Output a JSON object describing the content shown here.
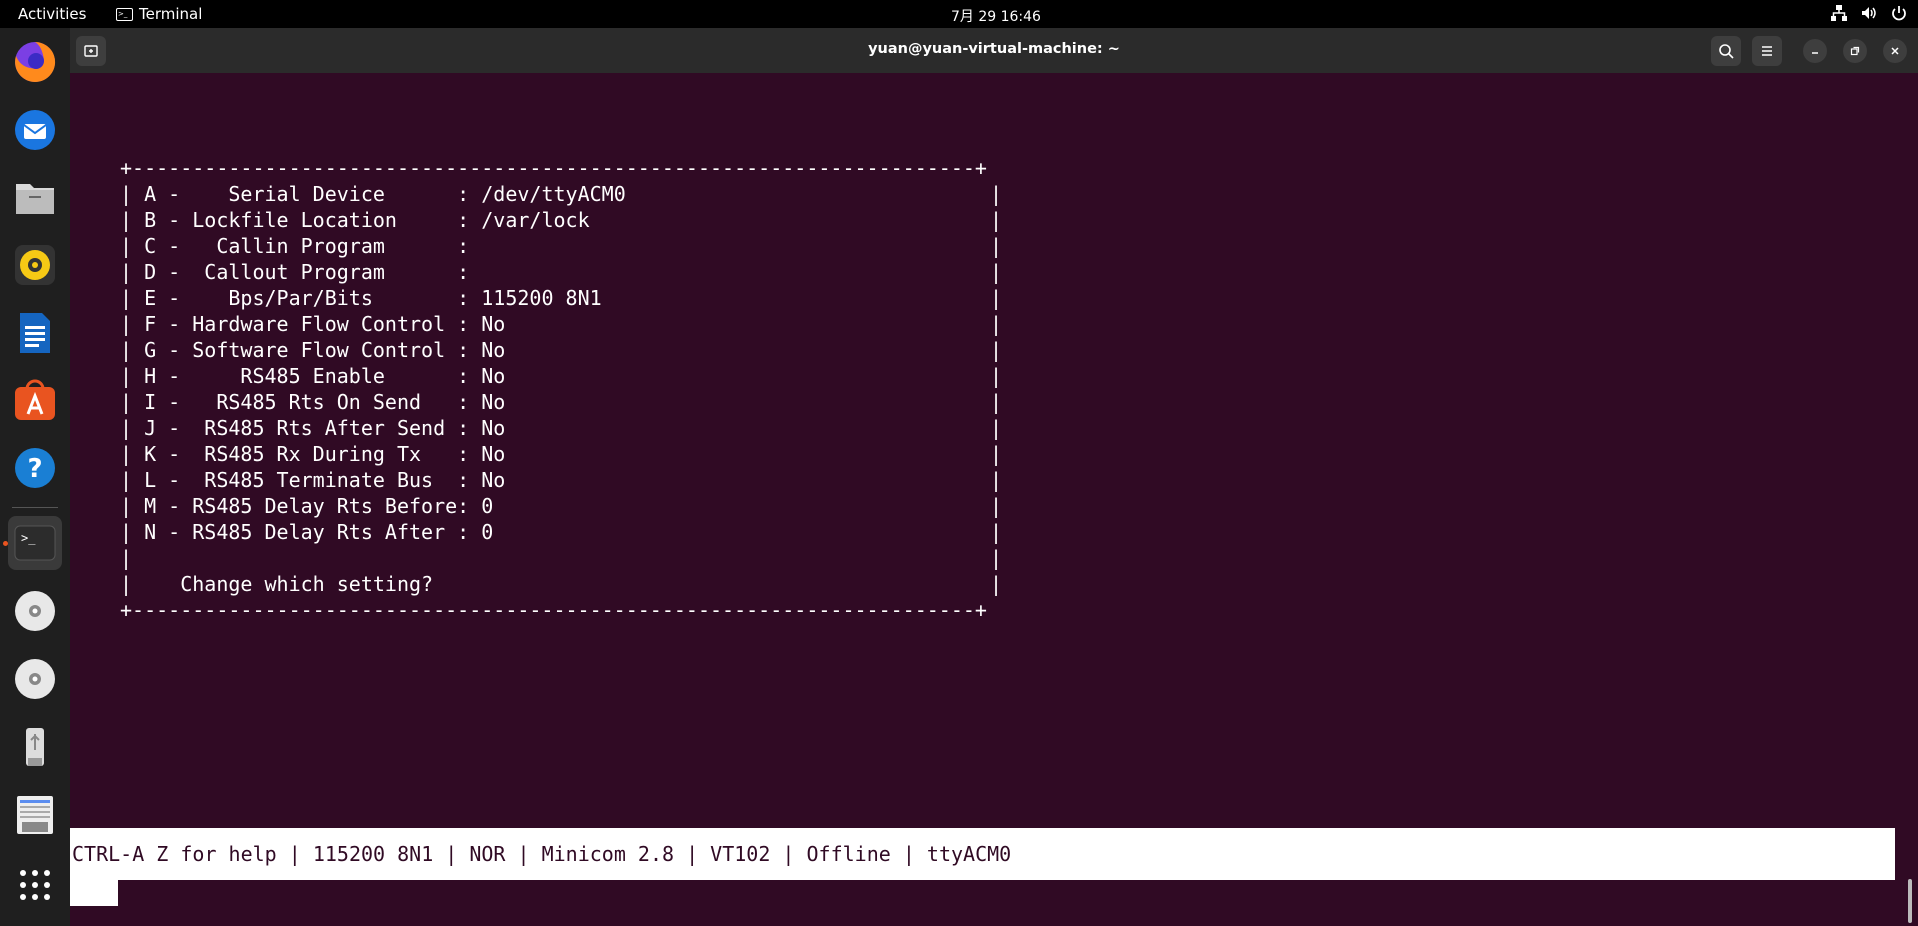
{
  "topbar": {
    "activities": "Activities",
    "app_name": "Terminal",
    "clock": "7月 29  16:46",
    "tray_icons": [
      "network-icon",
      "volume-icon",
      "power-icon"
    ]
  },
  "dock": {
    "items": [
      "firefox-icon",
      "thunderbird-icon",
      "files-icon",
      "rhythmbox-icon",
      "writer-icon",
      "app-center-icon",
      "help-icon",
      "terminal-icon",
      "dvd-icon",
      "dvd-icon",
      "usb-drive-icon",
      "trash-icon",
      "show-apps-icon"
    ],
    "accent": "#e95420"
  },
  "window": {
    "title": "yuan@yuan-virtual-machine: ~",
    "colors": {
      "background": "#300a24",
      "titlebar": "#2b2b2b"
    }
  },
  "minicom": {
    "border_top": "+----------------------------------------------------------------------+",
    "settings": [
      {
        "key": "A",
        "label": "   Serial Device      ",
        "value": "/dev/ttyACM0"
      },
      {
        "key": "B",
        "label": "Lockfile Location     ",
        "value": "/var/lock"
      },
      {
        "key": "C",
        "label": "  Callin Program      ",
        "value": ""
      },
      {
        "key": "D",
        "label": " Callout Program      ",
        "value": ""
      },
      {
        "key": "E",
        "label": "   Bps/Par/Bits       ",
        "value": "115200 8N1"
      },
      {
        "key": "F",
        "label": "Hardware Flow Control ",
        "value": "No"
      },
      {
        "key": "G",
        "label": "Software Flow Control ",
        "value": "No"
      },
      {
        "key": "H",
        "label": "    RS485 Enable      ",
        "value": "No"
      },
      {
        "key": "I",
        "label": "  RS485 Rts On Send   ",
        "value": "No"
      },
      {
        "key": "J",
        "label": " RS485 Rts After Send ",
        "value": "No"
      },
      {
        "key": "K",
        "label": " RS485 Rx During Tx   ",
        "value": "No"
      },
      {
        "key": "L",
        "label": " RS485 Terminate Bus  ",
        "value": "No"
      },
      {
        "key": "M",
        "label": "RS485 Delay Rts Before",
        "value": "0"
      },
      {
        "key": "N",
        "label": "RS485 Delay Rts After ",
        "value": "0"
      }
    ],
    "prompt": "Change which setting?",
    "status_line": "CTRL-A Z for help | 115200 8N1 | NOR | Minicom 2.8 | VT102 | Offline | ttyACM0"
  }
}
